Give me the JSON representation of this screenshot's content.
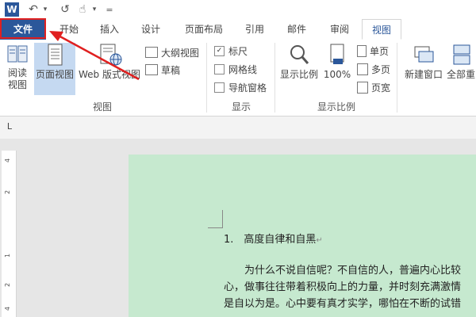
{
  "quick_access": {
    "app_icon": "W",
    "undo_icon": "↶",
    "redo_icon": "↺",
    "touch_icon": "☝",
    "dropdown": "▾",
    "customize": "="
  },
  "tabs": [
    "文件",
    "开始",
    "插入",
    "设计",
    "页面布局",
    "引用",
    "邮件",
    "审阅",
    "视图"
  ],
  "ribbon": {
    "views": {
      "read_mode": "阅读视图",
      "print_layout": "页面视图",
      "web_layout": "Web 版式视图",
      "outline": "大纲视图",
      "draft": "草稿",
      "group": "视图"
    },
    "show": {
      "ruler": "标尺",
      "gridlines": "网格线",
      "nav_pane": "导航窗格",
      "group": "显示",
      "ruler_checked": true
    },
    "zoom": {
      "zoom": "显示比例",
      "hundred": "100%",
      "one_page": "单页",
      "multi_page": "多页",
      "page_width": "页宽",
      "group": "显示比例"
    },
    "window": {
      "new_window": "新建窗口",
      "arrange_all": "全部重"
    }
  },
  "ruler": {
    "tab_marker": "L",
    "ticks": [
      "4",
      "2",
      "1",
      "2",
      "4"
    ]
  },
  "document": {
    "heading": "1.　高度自律和自黑",
    "return_mark": "↵",
    "line1": "为什么不说自信呢？不自信的人，普遍内心比较",
    "line2": "心，做事往往带着积极向上的力量，并时刻充满激情",
    "line3": "是自以为是。心中要有真才实学，哪怕在不断的试错"
  },
  "colors": {
    "file_tab": "#2b579a",
    "page_bg": "#c6e9cf",
    "highlight": "#e02020",
    "selected": "#c5d9f1"
  }
}
